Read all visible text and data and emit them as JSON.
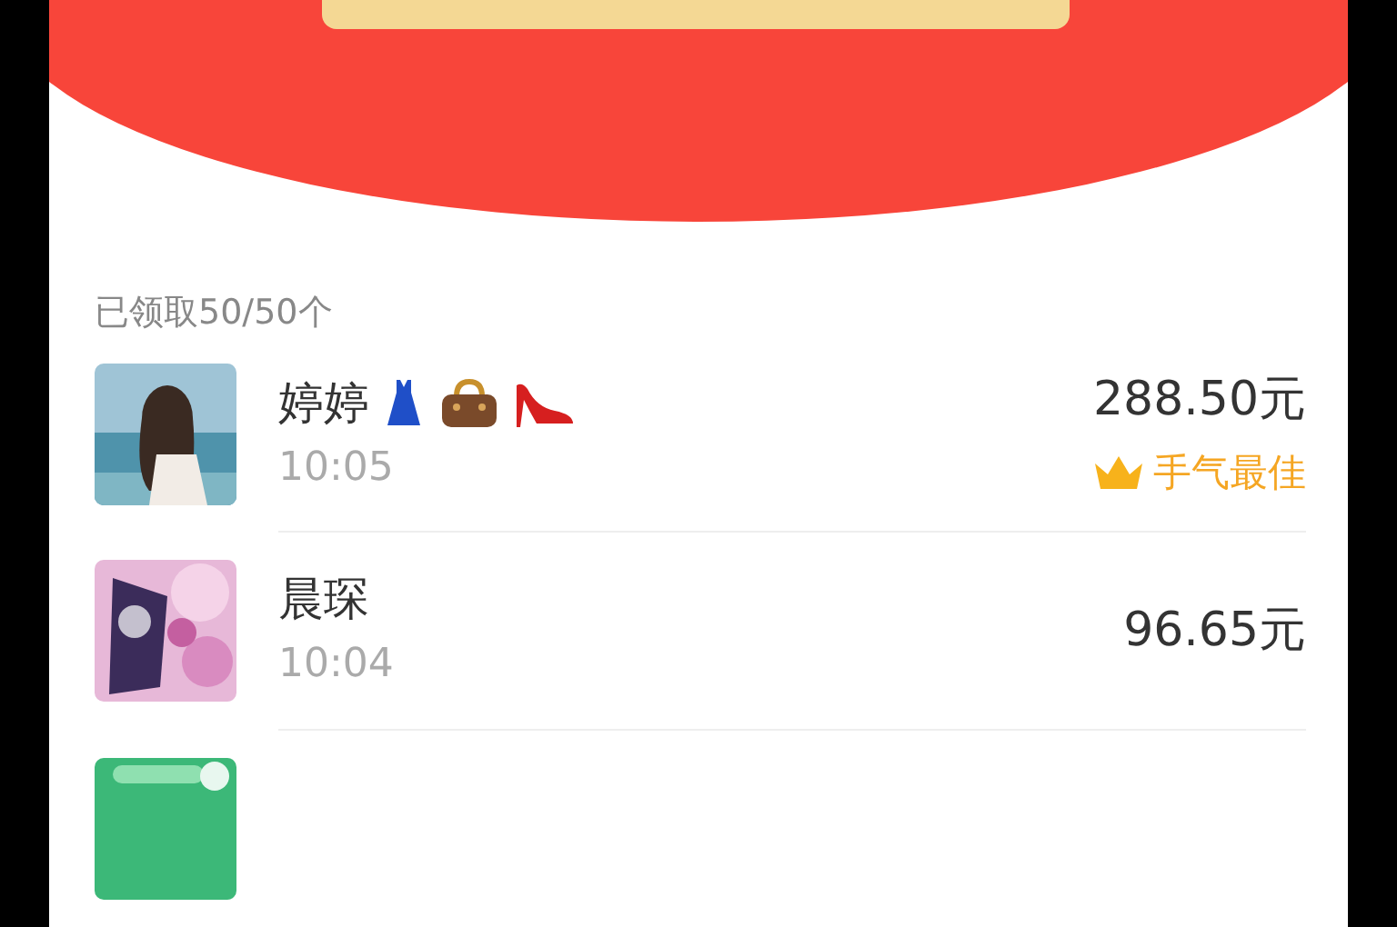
{
  "header": {
    "button": {
      "kind": "button"
    }
  },
  "summary": "已领取50/50个",
  "entries": [
    {
      "avatar": {
        "kind": "picture"
      },
      "name": "婷婷",
      "icons": [
        {
          "kind": "dress"
        },
        {
          "kind": "handbag"
        },
        {
          "kind": "heel"
        }
      ],
      "time": "10:05",
      "amount": "288.50元",
      "best": true,
      "best_label": "手气最佳"
    },
    {
      "avatar": {
        "kind": "picture"
      },
      "name": "晨琛",
      "time": "10:04",
      "amount": "96.65元",
      "best": false
    },
    {
      "avatar": {
        "kind": "picture"
      }
    }
  ]
}
